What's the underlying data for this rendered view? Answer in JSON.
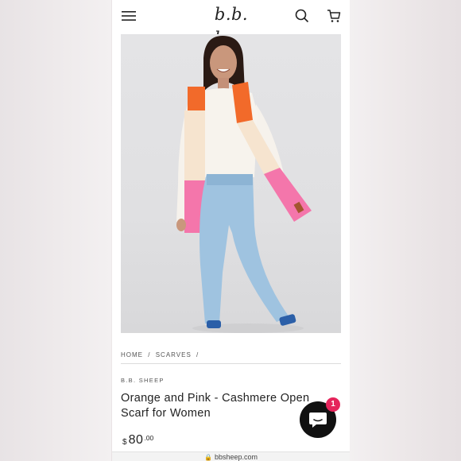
{
  "header": {
    "logo_text": "b.b. sheep",
    "menu_icon": "hamburger-menu-icon",
    "search_icon": "search-icon",
    "cart_icon": "cart-icon"
  },
  "hero_image": {
    "description_icon": "product-photo",
    "scarf_colors": [
      "#f26a2a",
      "#f6e7d6",
      "#f476ab"
    ]
  },
  "breadcrumb": {
    "items": [
      "HOME",
      "/",
      "SCARVES",
      "/"
    ]
  },
  "product": {
    "brand": "B.B. SHEEP",
    "title": "Orange and Pink - Cashmere Open Scarf for Women",
    "currency": "$",
    "price_whole": "80",
    "price_cents": ".00"
  },
  "chat": {
    "icon": "chat-bubble-icon",
    "badge_count": "1"
  },
  "urlbar": {
    "text": "bbsheep.com"
  }
}
